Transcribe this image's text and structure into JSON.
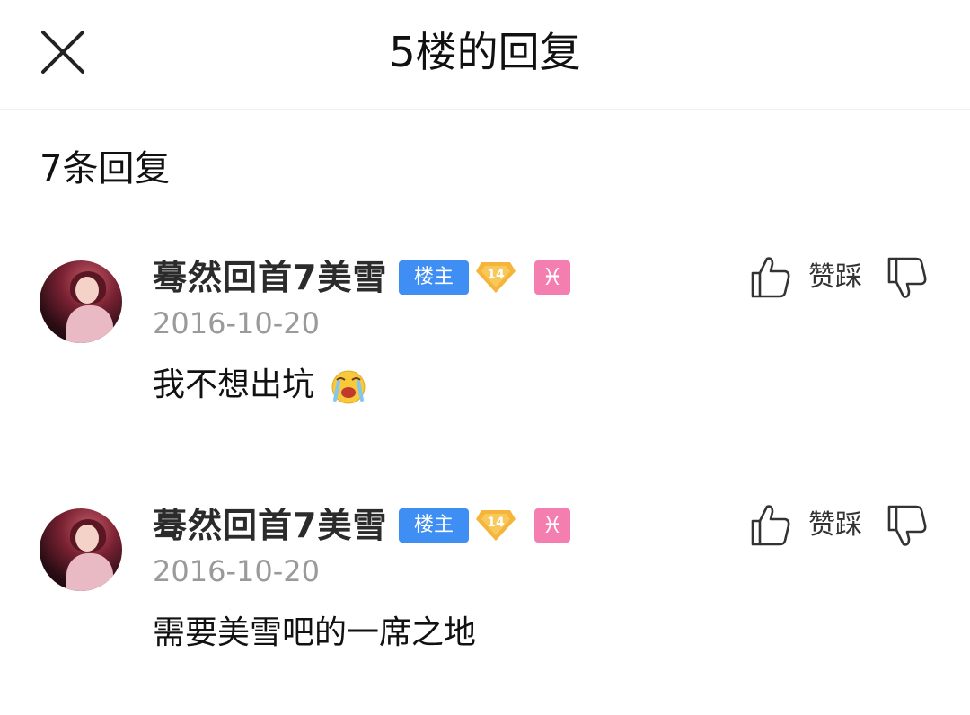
{
  "header": {
    "title": "5楼的回复",
    "close_icon": "close-icon"
  },
  "reply_count_label": "7条回复",
  "replies": [
    {
      "username": "蓦然回首7美雪",
      "badge_owner": "楼主",
      "level": "14",
      "zodiac_symbol": "♓",
      "date": "2016-10-20",
      "content": "我不想出坑",
      "emoji": "crying-face-emoji",
      "vote_label": "赞踩"
    },
    {
      "username": "蓦然回首7美雪",
      "badge_owner": "楼主",
      "level": "14",
      "zodiac_symbol": "♓",
      "date": "2016-10-20",
      "content": "需要美雪吧的一席之地",
      "vote_label": "赞踩"
    }
  ],
  "colors": {
    "owner_badge": "#3f8ef3",
    "level_badge": "#f5b43a",
    "pisces_badge": "#f47eb0",
    "date_gray": "#9a9a9a"
  }
}
